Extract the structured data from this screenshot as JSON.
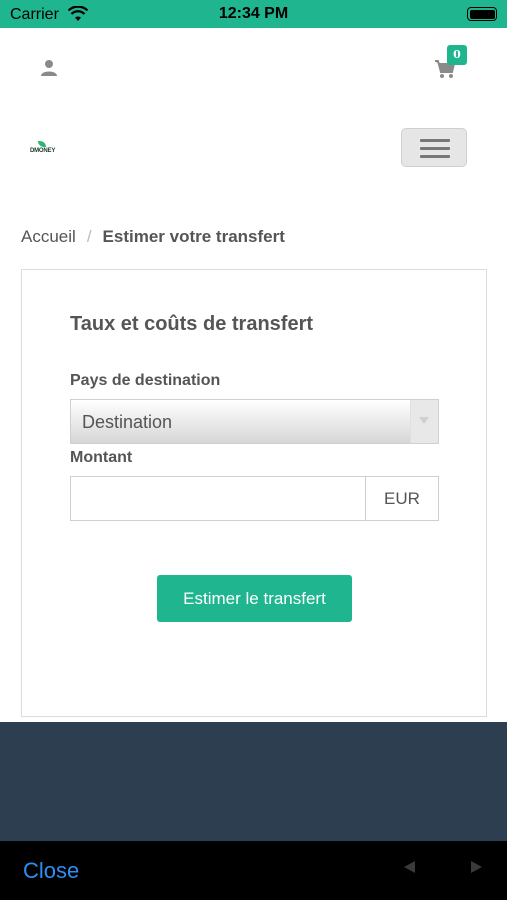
{
  "status_bar": {
    "carrier": "Carrier",
    "time": "12:34 PM",
    "wifi_icon": "wifi-icon",
    "battery_icon": "battery-icon"
  },
  "header": {
    "user_icon": "user-icon",
    "cart_icon": "cart-icon",
    "cart_count": "0",
    "logo_text": "DMONEY",
    "menu_icon": "hamburger-icon"
  },
  "breadcrumb": {
    "home": "Accueil",
    "separator": "/",
    "current": "Estimer votre transfert"
  },
  "form": {
    "title": "Taux et coûts de transfert",
    "country_label": "Pays de destination",
    "country_selected": "Destination",
    "amount_label": "Montant",
    "amount_value": "",
    "currency": "EUR",
    "submit_label": "Estimer le transfert"
  },
  "bottom_bar": {
    "close_label": "Close",
    "back_icon": "back-arrow-icon",
    "forward_icon": "forward-arrow-icon"
  },
  "colors": {
    "accent": "#1fb58f",
    "footer": "#2e3e51",
    "link": "#2b8ff5"
  }
}
